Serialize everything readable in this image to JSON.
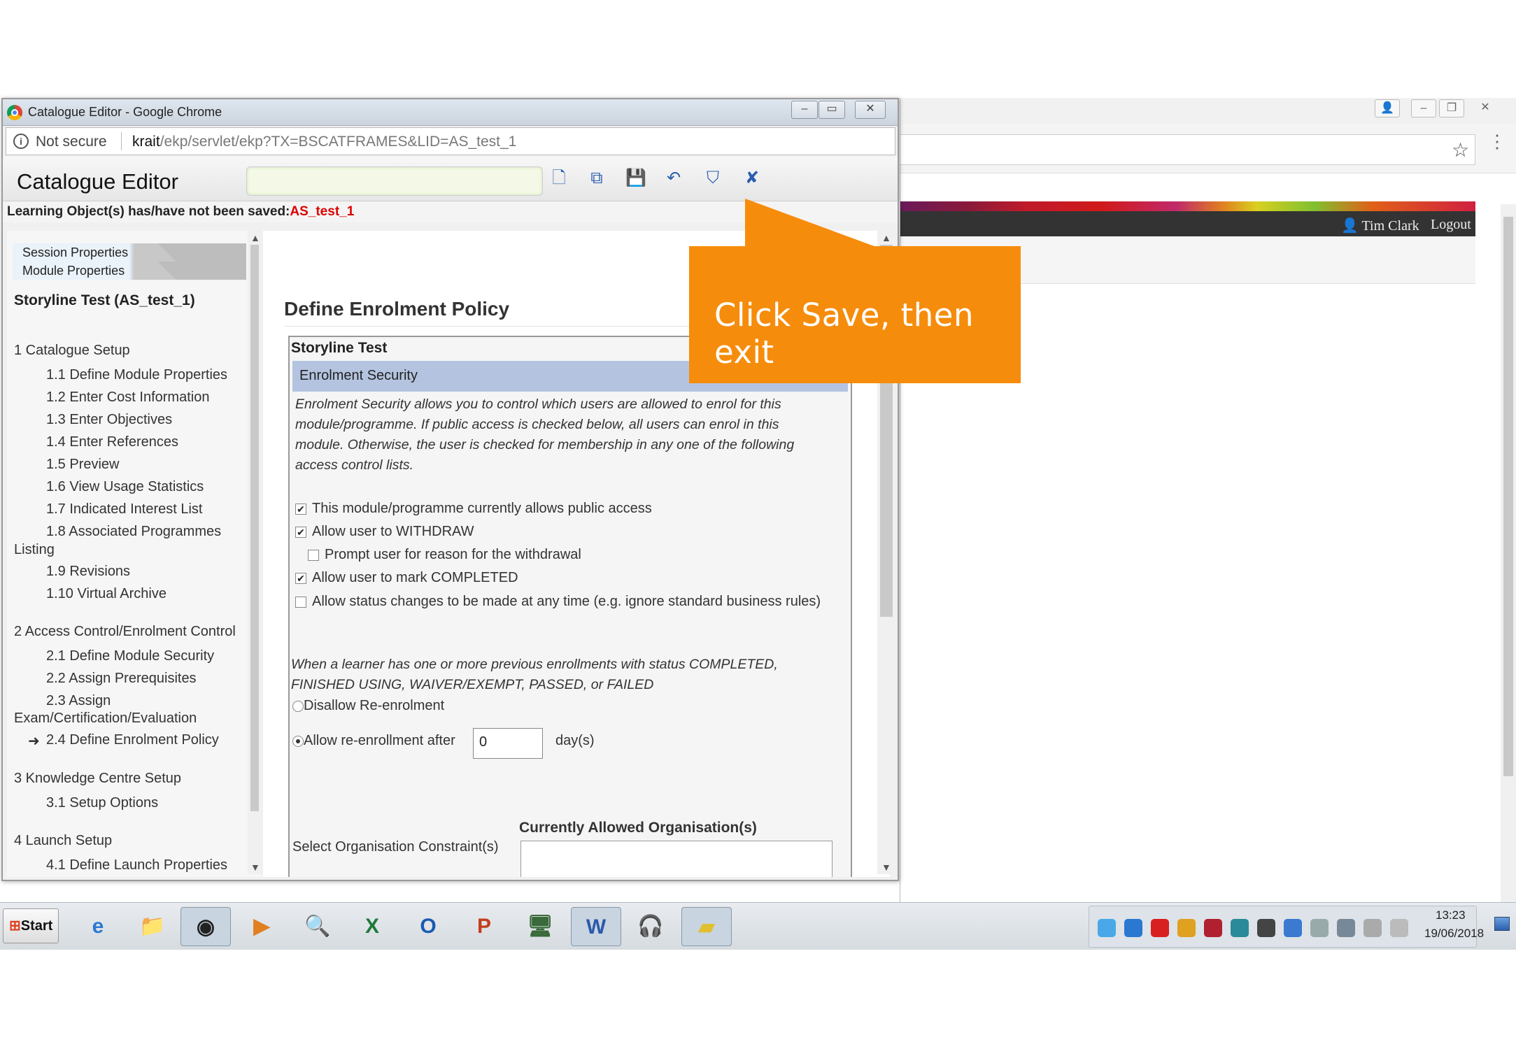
{
  "window": {
    "title": "Catalogue Editor - Google Chrome"
  },
  "address": {
    "not_secure": "Not secure",
    "host": "krait",
    "path": "/ekp/servlet/ekp?TX=BSCATFRAMES&LID=AS_test_1"
  },
  "toolbar": {
    "title": "Catalogue Editor",
    "search_value": ""
  },
  "notice": {
    "text": "Learning Object(s) has/have not been saved:",
    "id": "AS_test_1"
  },
  "left": {
    "tabs": [
      "Session Properties",
      "Module Properties"
    ],
    "course_title": "Storyline Test (AS_test_1)",
    "nav": [
      "1 Catalogue Setup",
      "1.1 Define Module Properties",
      "1.2 Enter Cost Information",
      "1.3 Enter Objectives",
      "1.4 Enter References",
      "1.5 Preview",
      "1.6 View Usage Statistics",
      "1.7 Indicated Interest List",
      "1.8 Associated Programmes",
      "Listing",
      "1.9 Revisions",
      "1.10 Virtual Archive",
      "2 Access Control/Enrolment Control",
      "2.1 Define Module Security",
      "2.2 Assign Prerequisites",
      "2.3 Assign",
      "Exam/Certification/Evaluation",
      "2.4 Define Enrolment Policy",
      "3 Knowledge Centre Setup",
      "3.1 Setup Options",
      "4 Launch Setup",
      "4.1 Define Launch Properties"
    ],
    "current_arrow": "➜"
  },
  "content": {
    "section_title": "Define Enrolment Policy",
    "box_title": "Storyline Test",
    "subsection": "Enrolment Security",
    "description": [
      "Enrolment Security allows you to control which users are allowed to enrol for this",
      "module/programme. If public access is checked below, all users can enrol in this",
      "module. Otherwise, the user is checked for membership in any one of the following",
      "access control lists."
    ],
    "options": [
      {
        "label": "This module/programme currently allows public access",
        "checked": true
      },
      {
        "label": "Allow user to WITHDRAW",
        "checked": true
      },
      {
        "label": "Prompt user for reason for the withdrawal",
        "checked": false
      },
      {
        "label": "Allow user to mark COMPLETED",
        "checked": true
      },
      {
        "label": "Allow status changes to be made at any time (e.g. ignore standard business rules)",
        "checked": false
      }
    ],
    "reenrol_desc": [
      "When a learner has one or more previous enrollments with status COMPLETED,",
      "FINISHED USING, WAIVER/EXEMPT, PASSED, or FAILED"
    ],
    "radio_disallow": "Disallow Re-enrolment",
    "radio_allow": "Allow re-enrollment after",
    "days_value": "0",
    "days_unit": "day(s)",
    "org_header": "Currently Allowed Organisation(s)",
    "org_label": "Select Organisation Constraint(s)"
  },
  "callout": {
    "text": "Click Save, then exit",
    "color": "#f68c0b"
  },
  "background_page": {
    "user": "Tim Clark",
    "logout": "Logout"
  },
  "taskbar": {
    "start": "Start",
    "time": "13:23",
    "date": "19/06/2018"
  }
}
